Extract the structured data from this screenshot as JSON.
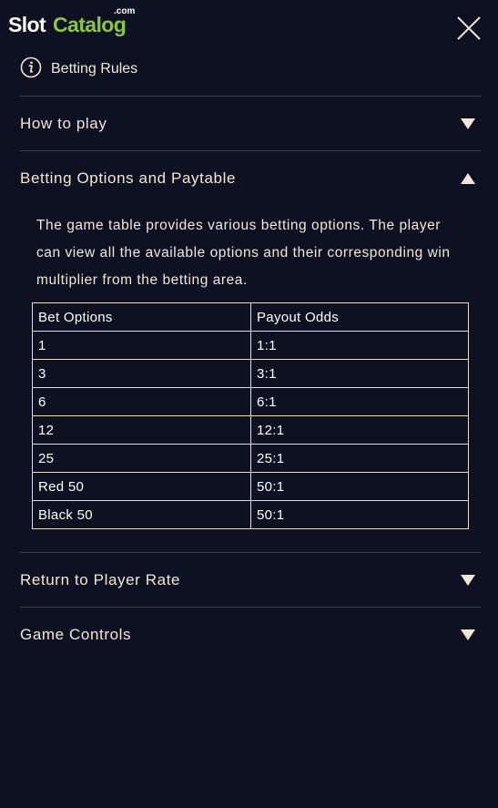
{
  "logo": {
    "slot": "Slot",
    "catalog": "Catalog",
    "com": ".com",
    "colors": {
      "slot": "#ffffff",
      "catalog": "#8cc63f"
    }
  },
  "close_icon": "close-icon",
  "header": {
    "icon": "info-icon",
    "title": "Betting Rules"
  },
  "sections": [
    {
      "label": "How to play",
      "expanded": false
    },
    {
      "label": "Betting Options and Paytable",
      "expanded": true
    },
    {
      "label": "Return to Player Rate",
      "expanded": false
    },
    {
      "label": "Game Controls",
      "expanded": false
    }
  ],
  "betting": {
    "description": "The game table provides various betting options. The player can view all the available options and their corresponding win multiplier from the betting area.",
    "table": {
      "headers": [
        "Bet Options",
        "Payout Odds"
      ],
      "rows": [
        [
          "1",
          "1:1"
        ],
        [
          "3",
          "3:1"
        ],
        [
          "6",
          "6:1"
        ],
        [
          "12",
          "12:1"
        ],
        [
          "25",
          "25:1"
        ],
        [
          "Red 50",
          "50:1"
        ],
        [
          "Black 50",
          "50:1"
        ]
      ]
    }
  },
  "colors": {
    "background": "#0d1121",
    "text": "#f3e6d6",
    "divider": "#3a3d4d",
    "table_border": "#eadccb"
  }
}
